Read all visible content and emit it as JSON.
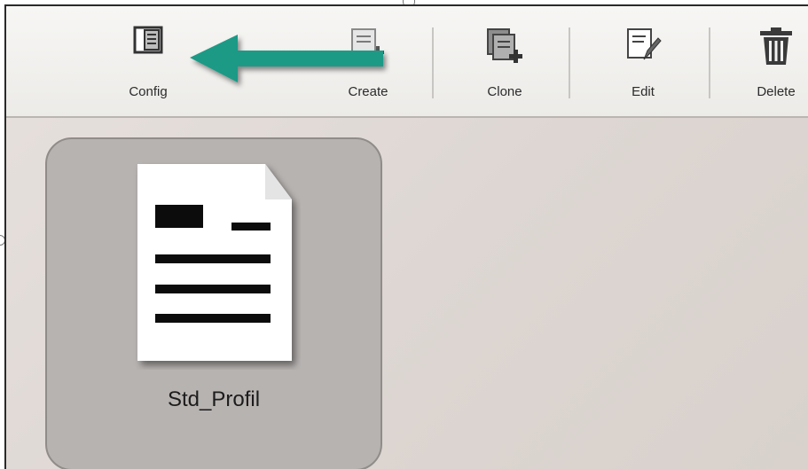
{
  "toolbar": {
    "buttons": [
      {
        "id": "config",
        "label": "Config",
        "icon": "config-panel-icon"
      },
      {
        "id": "create",
        "label": "Create",
        "icon": "create-document-icon"
      },
      {
        "id": "clone",
        "label": "Clone",
        "icon": "clone-documents-icon"
      },
      {
        "id": "edit",
        "label": "Edit",
        "icon": "edit-document-icon"
      },
      {
        "id": "delete",
        "label": "Delete",
        "icon": "trash-icon"
      }
    ]
  },
  "annotation": {
    "icon": "pointer-arrow-icon",
    "color": "#1f9a86"
  },
  "profiles": [
    {
      "name": "Std_Profil",
      "icon": "document-icon",
      "selected": true
    }
  ],
  "colors": {
    "toolbar_bg": "#efeeeb",
    "workspace_bg": "#e0dad6",
    "tile_bg": "#b7b3b1",
    "arrow": "#1f9a86"
  }
}
